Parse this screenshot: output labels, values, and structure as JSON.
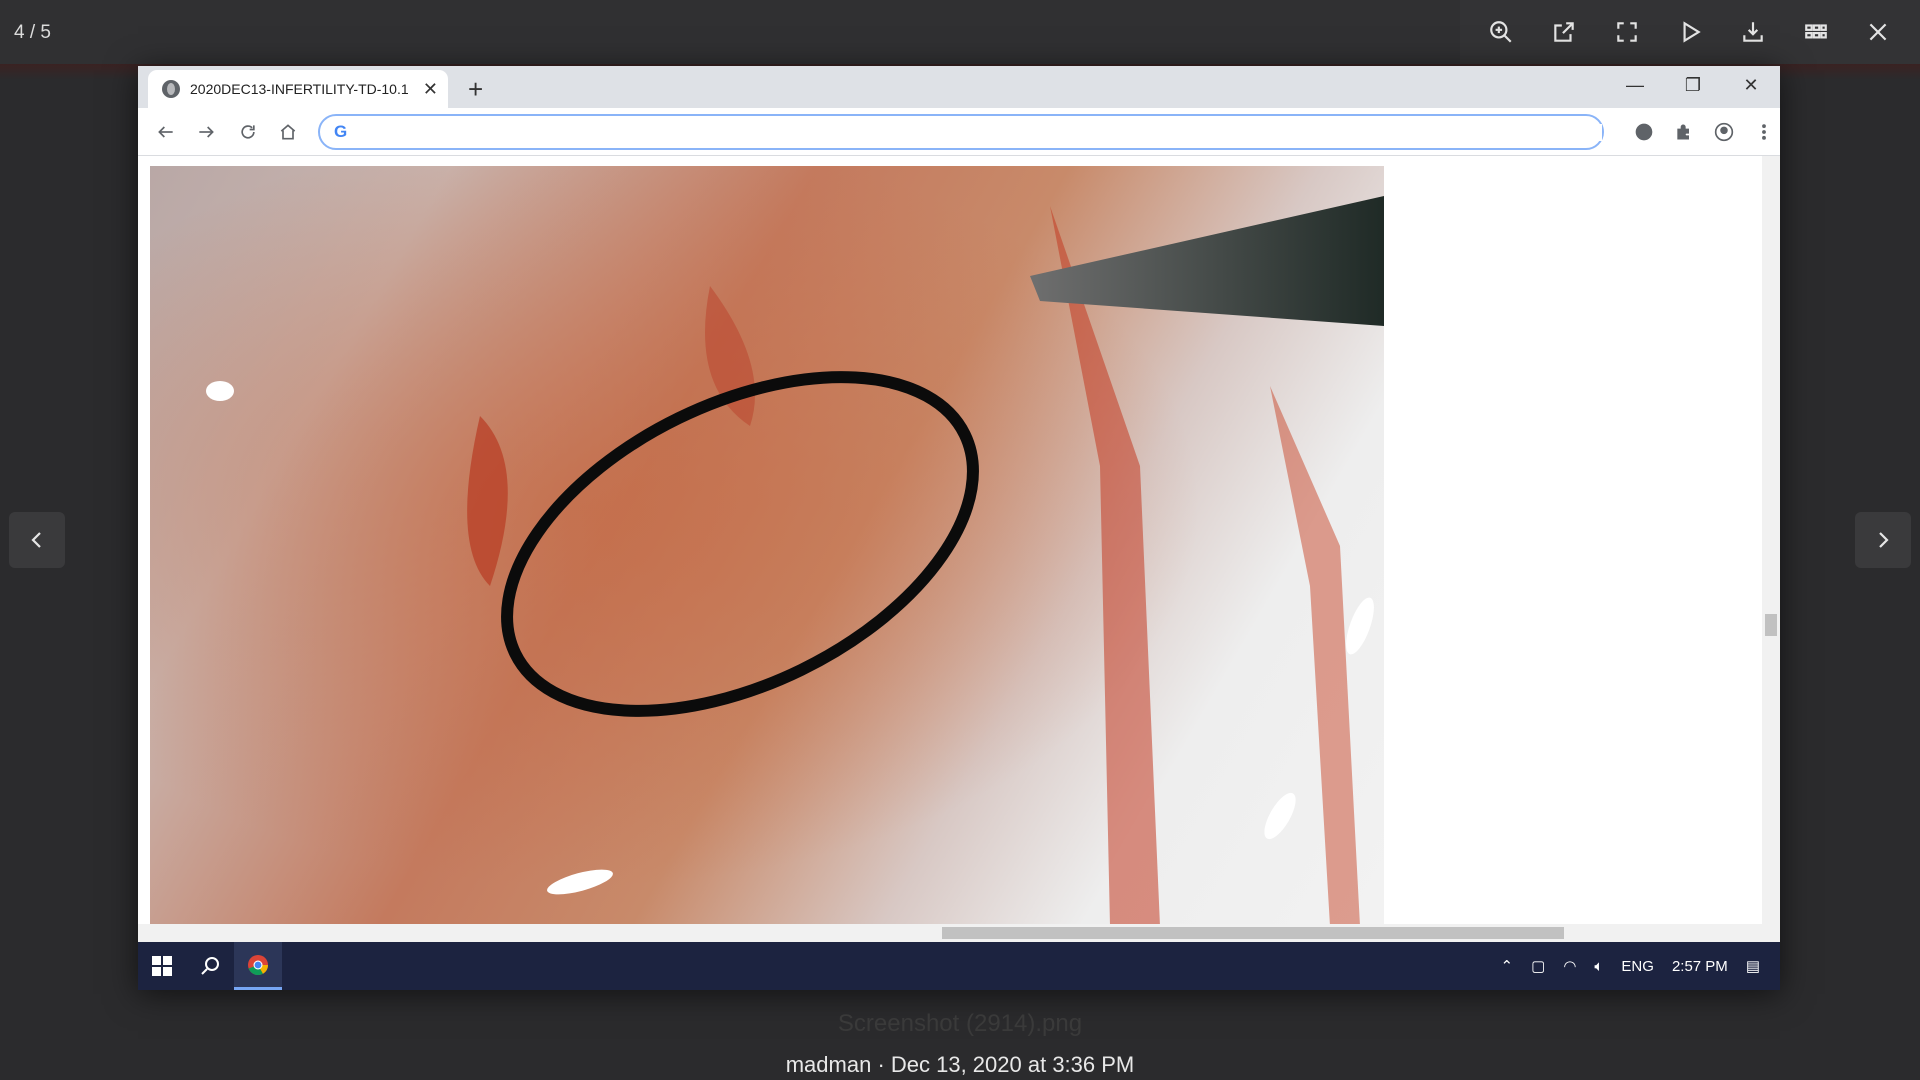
{
  "viewer": {
    "counter": "4 / 5",
    "tools": [
      "zoom-in-icon",
      "open-external-icon",
      "fullscreen-icon",
      "play-icon",
      "download-icon",
      "grid-icon",
      "close-icon"
    ],
    "caption_filename": "Screenshot (2914).png",
    "caption_meta": "madman · Dec 13, 2020 at 3:36 PM"
  },
  "browser": {
    "tab_title": "2020DEC13-INFERTILITY-TD-10.1",
    "tab_close": "✕",
    "new_tab": "+",
    "window_controls": [
      "—",
      "❐",
      "✕"
    ],
    "omnibox_logo": "G",
    "omnibox_value": "",
    "omnibox_placeholder": ""
  },
  "taskbar": {
    "language": "ENG",
    "time": "2:57 PM"
  },
  "colors": {
    "viewer_bg": "#2b2b2d",
    "taskbar_bg": "#1c2340",
    "omnibox_focus": "#8ab4f8"
  }
}
